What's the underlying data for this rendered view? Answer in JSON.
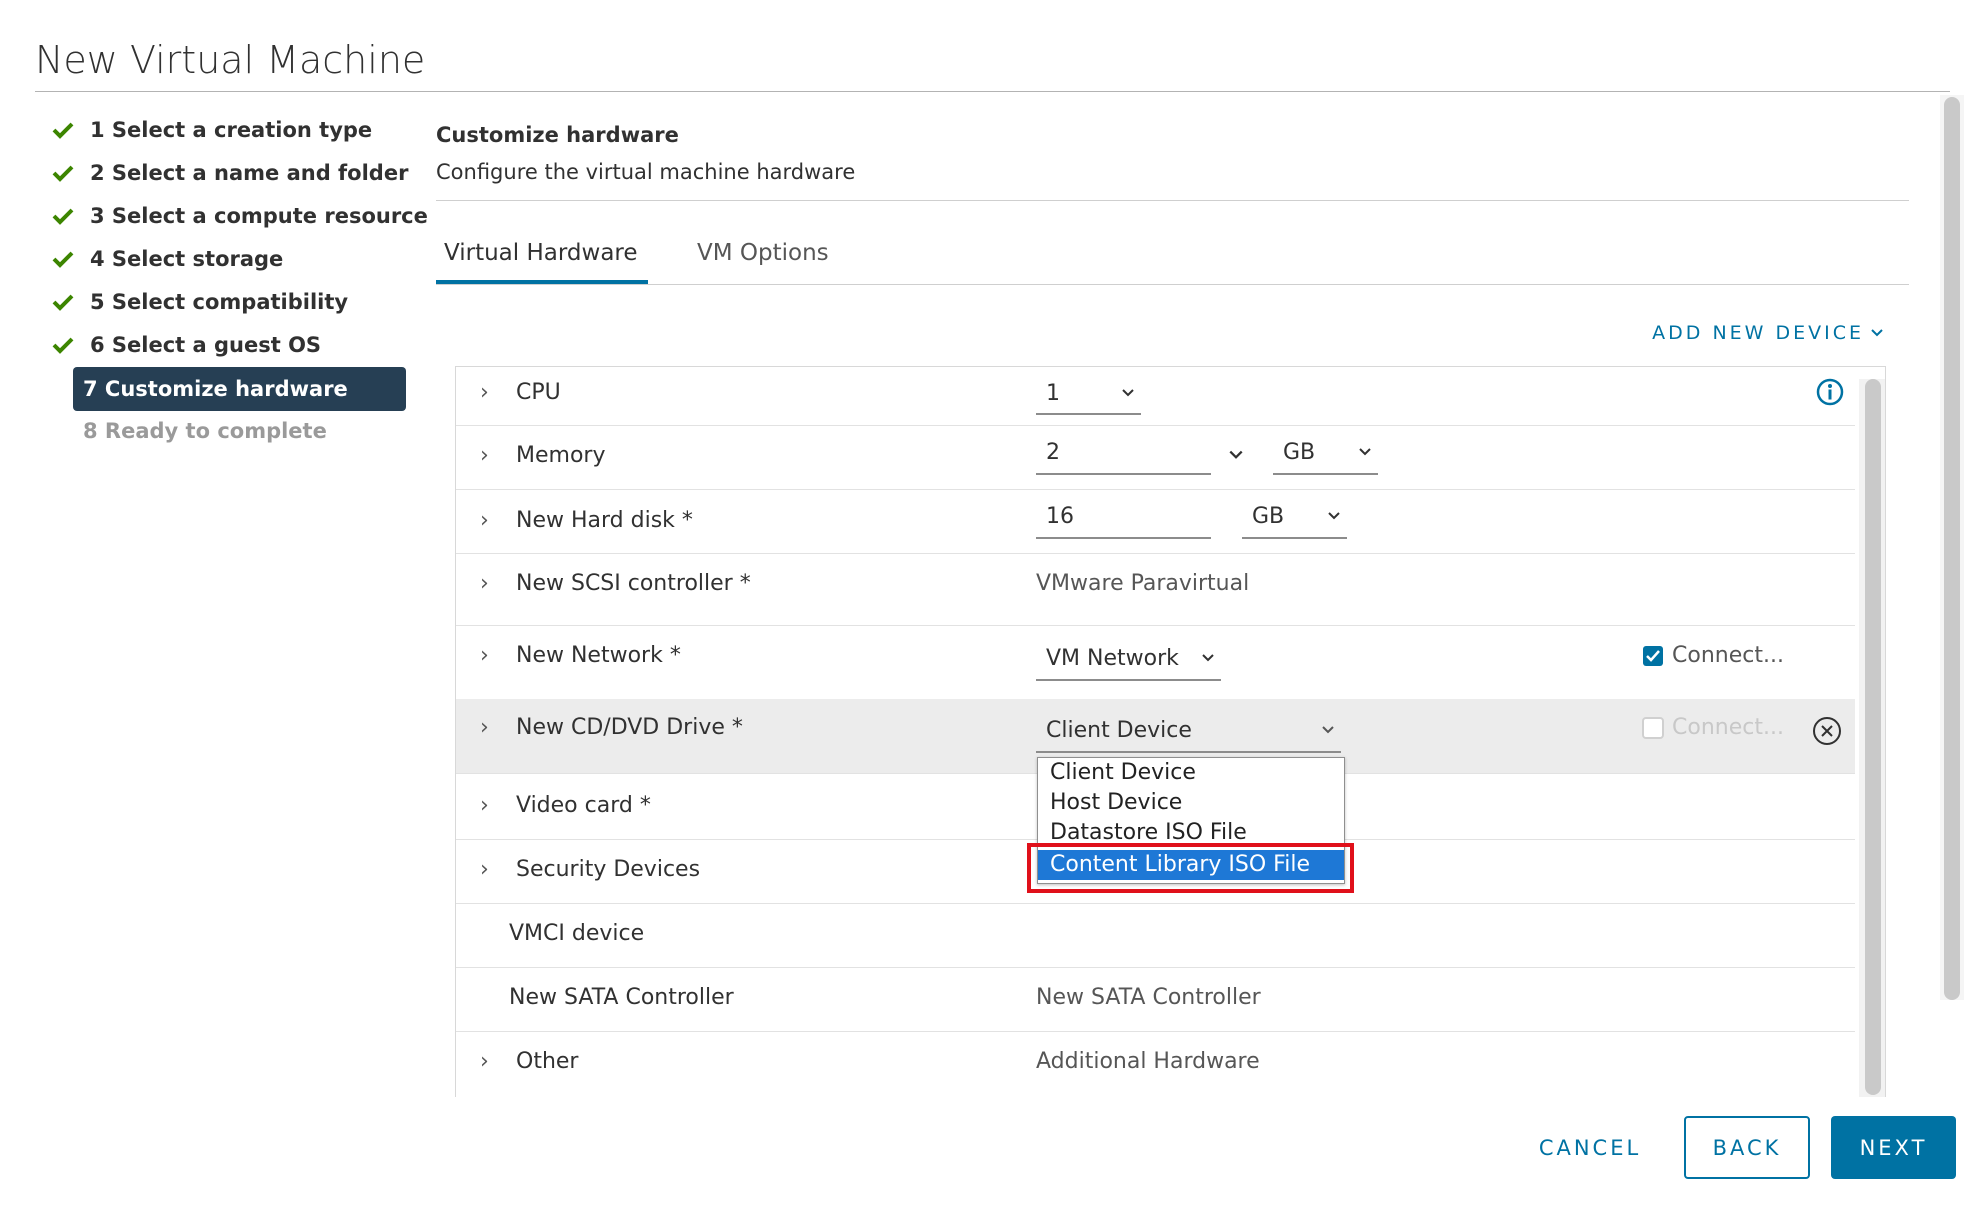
{
  "window_title": "New Virtual Machine",
  "steps": [
    {
      "label": "1 Select a creation type",
      "state": "done"
    },
    {
      "label": "2 Select a name and folder",
      "state": "done"
    },
    {
      "label": "3 Select a compute resource",
      "state": "done"
    },
    {
      "label": "4 Select storage",
      "state": "done"
    },
    {
      "label": "5 Select compatibility",
      "state": "done"
    },
    {
      "label": "6 Select a guest OS",
      "state": "done"
    },
    {
      "label": "7 Customize hardware",
      "state": "active"
    },
    {
      "label": "8 Ready to complete",
      "state": "disabled"
    }
  ],
  "header": {
    "title": "Customize hardware",
    "description": "Configure the virtual machine hardware"
  },
  "tabs": [
    {
      "label": "Virtual Hardware",
      "active": true
    },
    {
      "label": "VM Options",
      "active": false
    }
  ],
  "add_new_device": "ADD NEW DEVICE",
  "hardware": {
    "cpu": {
      "name": "CPU",
      "value": "1"
    },
    "memory": {
      "name": "Memory",
      "value": "2",
      "unit": "GB"
    },
    "hard_disk": {
      "name": "New Hard disk *",
      "value": "16",
      "unit": "GB"
    },
    "scsi": {
      "name": "New SCSI controller *",
      "value": "VMware Paravirtual"
    },
    "network": {
      "name": "New Network *",
      "value": "VM Network",
      "connect_label": "Connect...",
      "connect_checked": true
    },
    "cd_dvd": {
      "name": "New CD/DVD Drive *",
      "value": "Client Device",
      "connect_label": "Connect...",
      "connect_checked": false
    },
    "video": {
      "name": "Video card *"
    },
    "security": {
      "name": "Security Devices"
    },
    "vmci": {
      "name": "VMCI device"
    },
    "sata": {
      "name": "New SATA Controller",
      "value": "New SATA Controller"
    },
    "other": {
      "name": "Other",
      "value": "Additional Hardware"
    }
  },
  "cd_dropdown_options": [
    {
      "label": "Client Device",
      "selected": false
    },
    {
      "label": "Host Device",
      "selected": false
    },
    {
      "label": "Datastore ISO File",
      "selected": false
    },
    {
      "label": "Content Library ISO File",
      "selected": true
    }
  ],
  "buttons": {
    "cancel": "CANCEL",
    "back": "BACK",
    "next": "NEXT"
  },
  "colors": {
    "accent": "#0072a3",
    "check_green": "#3c8500",
    "active_step_bg": "#263f54",
    "dropdown_selected": "#1e78d6",
    "callout_red": "#e0101a"
  }
}
